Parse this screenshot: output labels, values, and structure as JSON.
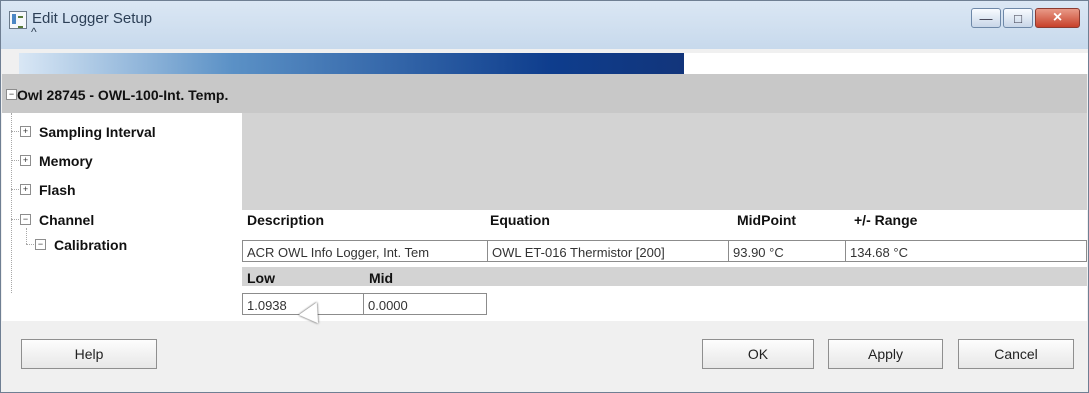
{
  "window": {
    "title": "Edit Logger Setup",
    "minimize_icon": "minimize-icon",
    "maximize_icon": "maximize-icon",
    "close_icon": "close-icon",
    "title_extra": "^"
  },
  "tree": {
    "root_label": "Owl 28745 - OWL-100-Int. Temp.",
    "items": [
      {
        "label": "Sampling Interval"
      },
      {
        "label": "Memory"
      },
      {
        "label": "Flash"
      },
      {
        "label": "Channel"
      },
      {
        "label": "Calibration"
      }
    ]
  },
  "channel": {
    "headers": {
      "description": "Description",
      "equation": "Equation",
      "midpoint": "MidPoint",
      "range": "+/- Range"
    },
    "values": {
      "description": "ACR OWL Info Logger, Int. Tem",
      "equation": "OWL ET-016 Thermistor  [200]",
      "midpoint": "93.90 °C",
      "range": "134.68 °C"
    }
  },
  "calibration": {
    "headers": {
      "low": "Low",
      "mid": "Mid"
    },
    "values": {
      "low": "1.0938",
      "mid": "0.0000"
    }
  },
  "buttons": {
    "help": "Help",
    "ok": "OK",
    "apply": "Apply",
    "cancel": "Cancel"
  },
  "colors": {
    "title_text": "#2c3f56",
    "close_button": "#c7412a",
    "band": "#0e3d8d"
  }
}
